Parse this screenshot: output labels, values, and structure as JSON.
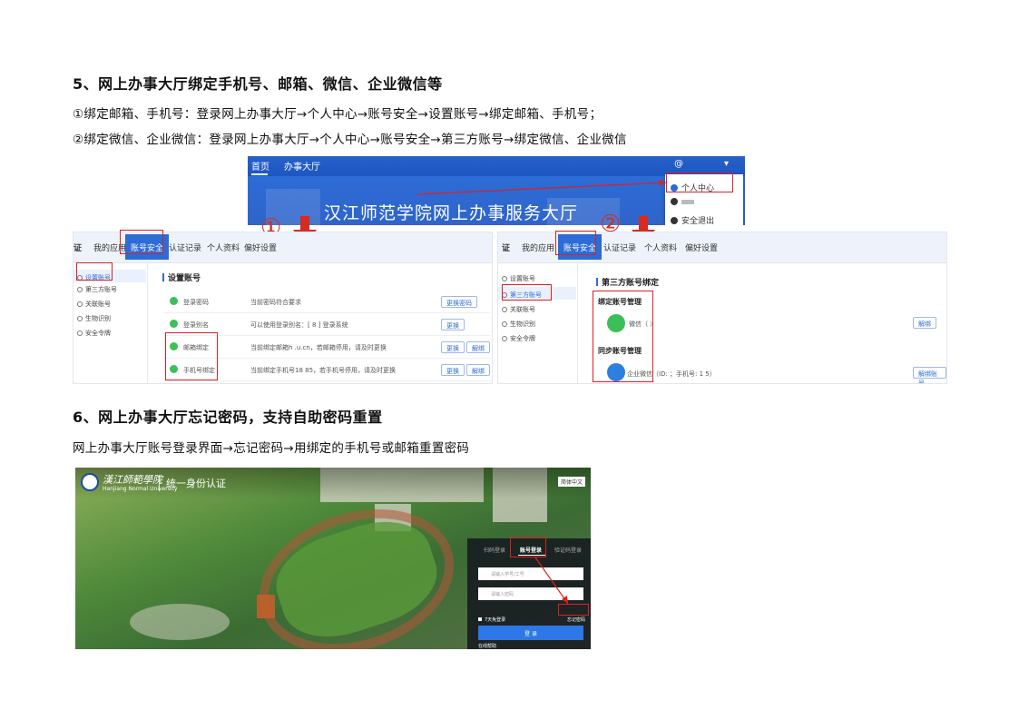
{
  "section5": {
    "heading": "5、网上办事大厅绑定手机号、邮箱、微信、企业微信等",
    "step1": "①绑定邮箱、手机号：登录网上办事大厅→个人中心→账号安全→设置账号→绑定邮箱、手机号；",
    "step2": "②绑定微信、企业微信：登录网上办事大厅→个人中心→账号安全→第三方账号→绑定微信、企业微信"
  },
  "banner": {
    "nav_home": "首页",
    "nav_hall": "办事大厅",
    "title": "汉江师范学院网上办事服务大厅",
    "user": "@",
    "menu_personal": "个人中心",
    "menu_logout": "安全退出",
    "marker1": "①",
    "marker2": "②"
  },
  "left_panel": {
    "tabs": [
      "证",
      "我的应用",
      "账号安全",
      "认证记录",
      "个人资料",
      "偏好设置"
    ],
    "side": [
      "设置账号",
      "第三方账号",
      "关联账号",
      "生物识别",
      "安全令牌"
    ],
    "section": "设置账号",
    "rows": [
      {
        "name": "登录密码",
        "desc": "当前密码符合要求",
        "btn": "更换密码"
      },
      {
        "name": "登录别名",
        "desc": "可以使用登录别名：[ 8 ] 登录系统",
        "btn": "更换"
      },
      {
        "name": "邮箱绑定",
        "desc": "当前绑定邮箱h           .u.cn，若邮箱停用，请及时更换",
        "btn": "更换",
        "btn2": "解绑"
      },
      {
        "name": "手机号绑定",
        "desc": "当前绑定手机号18        85，若手机号停用，请及时更换",
        "btn": "更换",
        "btn2": "解绑"
      }
    ]
  },
  "right_panel": {
    "tabs": [
      "证",
      "我的应用",
      "账号安全",
      "认证记录",
      "个人资料",
      "偏好设置"
    ],
    "side": [
      "设置账号",
      "第三方账号",
      "关联账号",
      "生物识别",
      "安全令牌"
    ],
    "section": "第三方账号绑定",
    "group1": "绑定账号管理",
    "wechat": "微信（ ）",
    "group2": "同步账号管理",
    "wework": "企业微信（ID:       ；手机号: 1        5）",
    "unbind": "解绑",
    "unbind2": "解绑账号"
  },
  "section6": {
    "heading": "6、网上办事大厅忘记密码，支持自助密码重置",
    "desc": "网上办事大厅账号登录界面→忘记密码→用绑定的手机号或邮箱重置密码"
  },
  "login": {
    "school_cn": "漢江師範學院",
    "school_en": "Hanjiang Normal University",
    "title": "统一身份认证",
    "lang": "简体中文",
    "tabs": [
      "扫码登录",
      "账号登录",
      "验证码登录"
    ],
    "user_placeholder": "请输入学号/工号",
    "pwd_placeholder": "请输入密码",
    "remember": "7天免登录",
    "forgot": "忘记密码",
    "submit": "登 录",
    "help": "在线帮助"
  },
  "colors": {
    "accent": "#2d6cd6",
    "highlight": "#e02020",
    "ok": "#3cbf59"
  }
}
